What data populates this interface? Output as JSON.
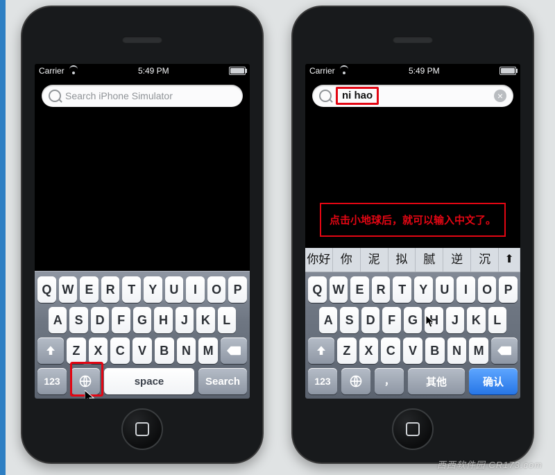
{
  "colors": {
    "highlight": "#e30613",
    "confirm_blue": "#2776e6"
  },
  "status": {
    "carrier": "Carrier",
    "time": "5:49 PM"
  },
  "left": {
    "search_placeholder": "Search iPhone Simulator",
    "keyboard": {
      "row1": [
        "Q",
        "W",
        "E",
        "R",
        "T",
        "Y",
        "U",
        "I",
        "O",
        "P"
      ],
      "row2": [
        "A",
        "S",
        "D",
        "F",
        "G",
        "H",
        "J",
        "K",
        "L"
      ],
      "row3": [
        "Z",
        "X",
        "C",
        "V",
        "B",
        "N",
        "M"
      ],
      "numeric": "123",
      "space": "space",
      "go": "Search"
    }
  },
  "right": {
    "search_value": "ni hao",
    "annotation": "点击小地球后，就可以输入中文了。",
    "candidates": [
      "你好",
      "你",
      "泥",
      "拟",
      "腻",
      "逆",
      "沉"
    ],
    "keyboard": {
      "row1": [
        "Q",
        "W",
        "E",
        "R",
        "T",
        "Y",
        "U",
        "I",
        "O",
        "P"
      ],
      "row2": [
        "A",
        "S",
        "D",
        "F",
        "G",
        "H",
        "J",
        "K",
        "L"
      ],
      "row3": [
        "Z",
        "X",
        "C",
        "V",
        "B",
        "N",
        "M"
      ],
      "numeric": "123",
      "comma": "，",
      "space": "其他",
      "go": "确认"
    }
  },
  "watermark": "西西软件园 CR173.com"
}
